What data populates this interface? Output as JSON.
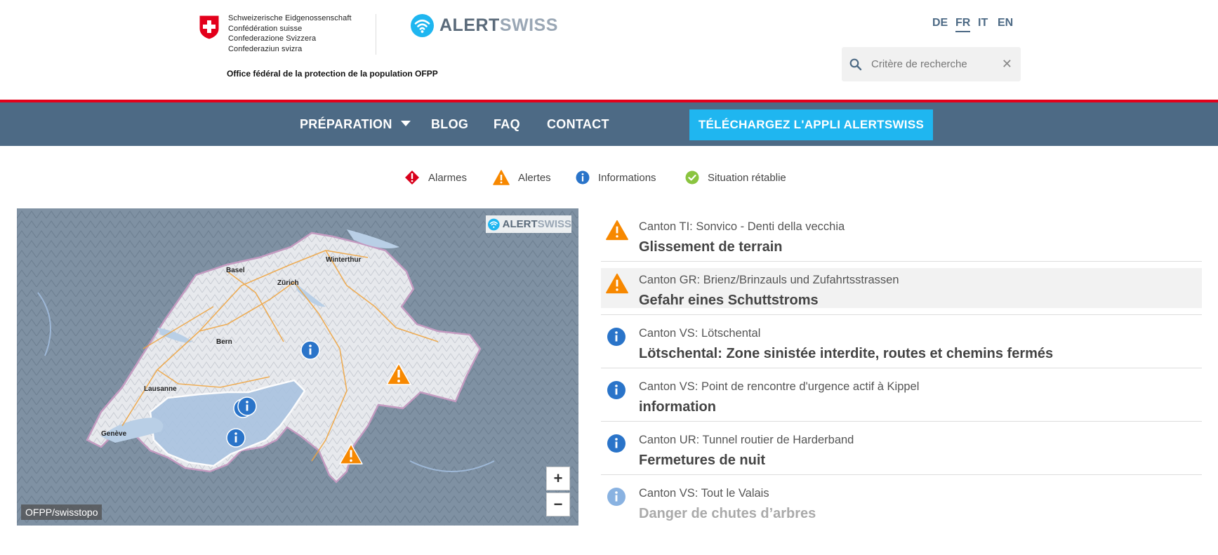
{
  "header": {
    "confederation_lines": [
      "Schweizerische Eidgenossenschaft",
      "Confédération suisse",
      "Confederazione Svizzera",
      "Confederaziun svizra"
    ],
    "office_name": "Office fédéral de la protection de la population OFPP",
    "brand_alert": "ALERT",
    "brand_swiss": "SWISS",
    "languages": [
      "DE",
      "FR",
      "IT",
      "EN"
    ],
    "active_language": "FR",
    "search_placeholder": "Critère de recherche"
  },
  "nav": {
    "items": [
      "PRÉPARATION",
      "BLOG",
      "FAQ",
      "CONTACT"
    ],
    "cta_label": "TÉLÉCHARGEZ L'APPLI ALERTSWISS"
  },
  "legend": [
    {
      "label": "Alarmes",
      "icon": "alarm-icon",
      "color": "#d9001b"
    },
    {
      "label": "Alertes",
      "icon": "warning-icon",
      "color": "#f78800"
    },
    {
      "label": "Informations",
      "icon": "info-icon",
      "color": "#2a74c9"
    },
    {
      "label": "Situation rétablie",
      "icon": "check-icon",
      "color": "#8ac43f"
    }
  ],
  "map": {
    "attribution": "OFPP/swisstopo",
    "badge_alert": "ALERT",
    "badge_swiss": "SWISS",
    "zoom_in": "+",
    "zoom_out": "−",
    "cities": [
      "Basel",
      "Winterthur",
      "Zürich",
      "Bern",
      "Lausanne",
      "Genève"
    ]
  },
  "events": [
    {
      "location": "Canton TI: Sonvico - Denti della vecchia",
      "title": "Glissement de terrain",
      "type": "warning"
    },
    {
      "location": "Canton GR: Brienz/Brinzauls und Zufahrtsstrassen",
      "title": "Gefahr eines Schuttstroms",
      "type": "warning"
    },
    {
      "location": "Canton VS: Lötschental",
      "title": "Lötschental: Zone sinistée interdite, routes et chemins fermés",
      "type": "info"
    },
    {
      "location": "Canton VS: Point de rencontre d'urgence actif à Kippel",
      "title": "information",
      "type": "info"
    },
    {
      "location": "Canton UR: Tunnel routier de Harderband",
      "title": "Fermetures de nuit",
      "type": "info"
    },
    {
      "location": "Canton VS: Tout le Valais",
      "title": "Danger de chutes d’arbres",
      "type": "info"
    }
  ],
  "colors": {
    "nav_bg": "#4d6a85",
    "cta_bg": "#1fb6f0",
    "red_line": "#e3001b",
    "warning": "#f78800",
    "info": "#2a74c9"
  }
}
